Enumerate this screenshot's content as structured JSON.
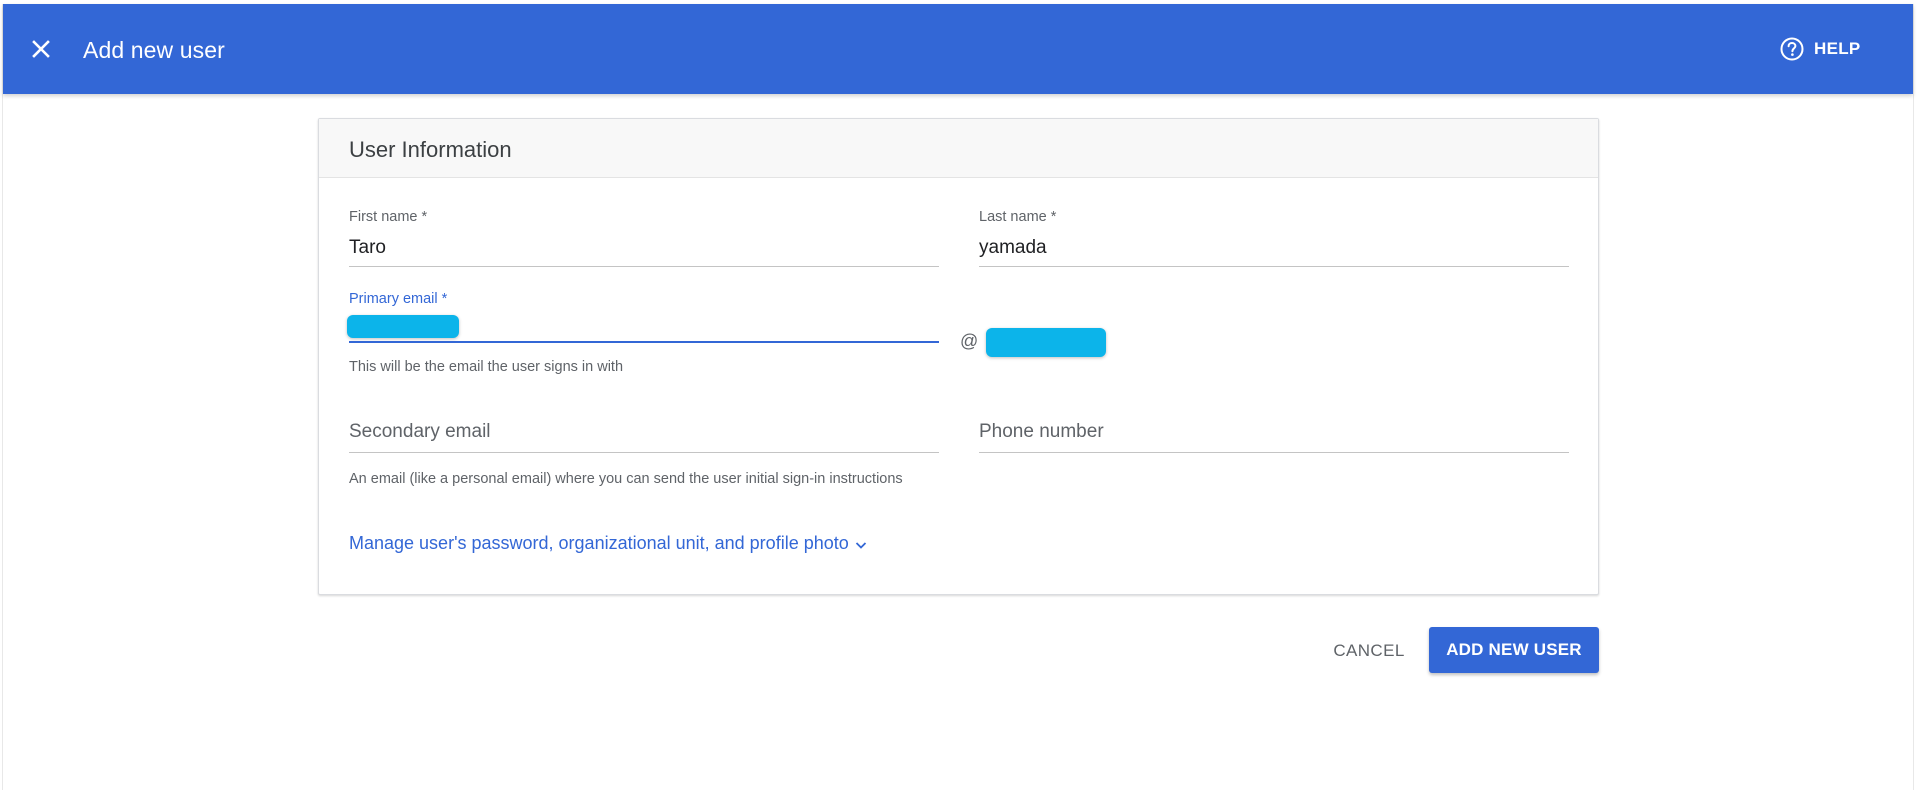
{
  "header": {
    "title": "Add new user",
    "help_label": "HELP",
    "close_icon": "close-icon",
    "help_icon": "help-circle-icon",
    "background_color": "#3367d6"
  },
  "card": {
    "title": "User Information",
    "first_name": {
      "label": "First name *",
      "value": "Taro"
    },
    "last_name": {
      "label": "Last name *",
      "value": "yamada"
    },
    "primary_email": {
      "label": "Primary email *",
      "at_sign": "@",
      "helper": "This will be the email the user signs in with"
    },
    "secondary_email": {
      "placeholder": "Secondary email",
      "helper": "An email (like a personal email) where you can send the user initial sign-in instructions"
    },
    "phone_number": {
      "placeholder": "Phone number"
    },
    "manage_link": "Manage user's password, organizational unit, and profile photo",
    "manage_link_icon": "chevron-down-icon"
  },
  "actions": {
    "cancel_label": "CANCEL",
    "add_label": "ADD NEW USER",
    "accent_color": "#3367d6"
  }
}
